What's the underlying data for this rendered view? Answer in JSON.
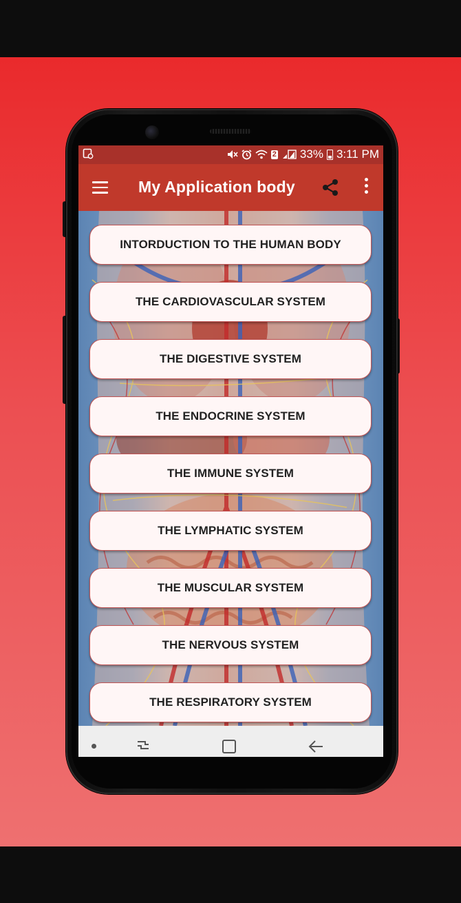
{
  "status_bar": {
    "battery_percent": "33%",
    "time": "3:11 PM",
    "notification_count": "2"
  },
  "app_bar": {
    "title": "My Application body"
  },
  "menu": {
    "items": [
      {
        "label": "INTORDUCTION TO THE HUMAN BODY"
      },
      {
        "label": "THE CARDIOVASCULAR SYSTEM"
      },
      {
        "label": "THE DIGESTIVE SYSTEM"
      },
      {
        "label": "THE ENDOCRINE SYSTEM"
      },
      {
        "label": "THE IMMUNE SYSTEM"
      },
      {
        "label": "THE LYMPHATIC SYSTEM"
      },
      {
        "label": "THE MUSCULAR SYSTEM"
      },
      {
        "label": "THE NERVOUS SYSTEM"
      },
      {
        "label": "THE RESPIRATORY SYSTEM"
      }
    ]
  },
  "colors": {
    "app_bar": "#c0392b",
    "status_bar": "#a8312a",
    "promo_gradient_top": "#ea2a2c",
    "promo_gradient_bottom": "#ee7070",
    "button_background": "#fff6f6"
  },
  "icons": {
    "menu": "hamburger-menu-icon",
    "share": "share-icon",
    "more": "more-vertical-icon",
    "nav_recent": "recent-apps-icon",
    "nav_home": "home-icon",
    "nav_back": "back-arrow-icon"
  }
}
